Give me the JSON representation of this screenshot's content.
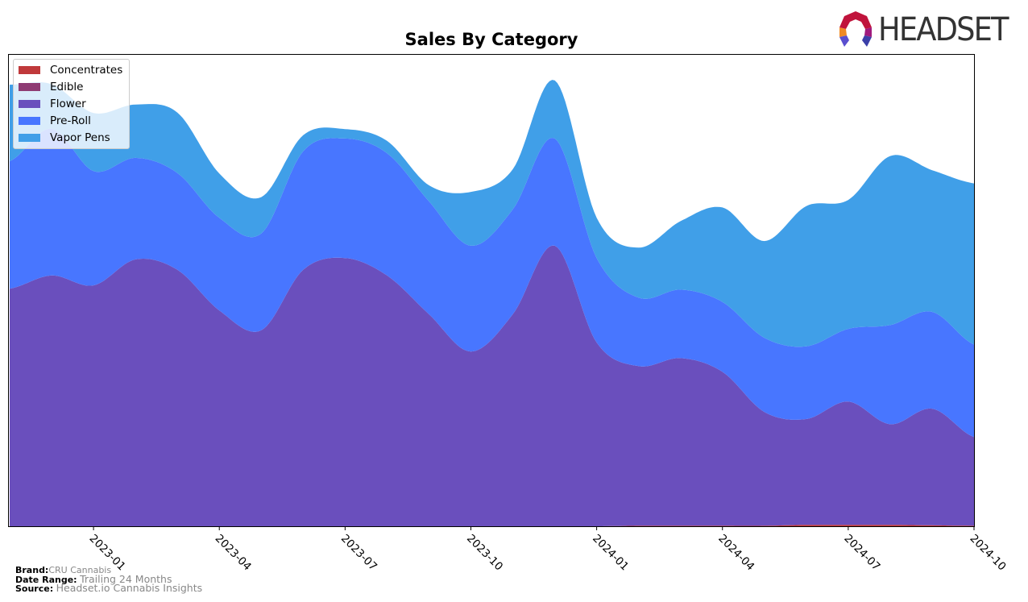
{
  "header": {
    "logo_text": "HEADSET",
    "logo_colors": [
      "#c0143c",
      "#f08a24",
      "#a01a7d",
      "#3b3fa8",
      "#5a4fcf"
    ]
  },
  "footer": {
    "brand_label": "Brand:",
    "brand_value": "CRU Cannabis",
    "date_range_label": "Date Range:",
    "date_range_value": "Trailing 24 Months",
    "source_label": "Source:",
    "source_value": "Headset.io Cannabis Insights"
  },
  "chart_data": {
    "type": "area",
    "stacked": true,
    "smoothed": true,
    "title": "Sales By Category",
    "xlabel": "",
    "ylabel": "",
    "y_ticks_visible": false,
    "grid": false,
    "legend_position": "top-left",
    "x": [
      "2022-11",
      "2022-12",
      "2023-01",
      "2023-02",
      "2023-03",
      "2023-04",
      "2023-05",
      "2023-06",
      "2023-07",
      "2023-08",
      "2023-09",
      "2023-10",
      "2023-11",
      "2023-12",
      "2024-01",
      "2024-02",
      "2024-03",
      "2024-04",
      "2024-05",
      "2024-06",
      "2024-07",
      "2024-08",
      "2024-09",
      "2024-10"
    ],
    "x_tick_labels": [
      "2023-01",
      "2023-04",
      "2023-07",
      "2023-10",
      "2024-01",
      "2024-04",
      "2024-07",
      "2024-10"
    ],
    "ylim": [
      0,
      100
    ],
    "series": [
      {
        "name": "Concentrates",
        "color": "#c0393b",
        "values": [
          0,
          0,
          0,
          0,
          0,
          0,
          0,
          0,
          0,
          0,
          0,
          0,
          0,
          0,
          0,
          0.1,
          0.1,
          0.1,
          0.1,
          0.3,
          0.3,
          0.3,
          0.2,
          0.1
        ]
      },
      {
        "name": "Edible",
        "color": "#8e3b73",
        "values": [
          0,
          0,
          0,
          0,
          0,
          0,
          0,
          0,
          0,
          0,
          0,
          0,
          0,
          0,
          0,
          0,
          0,
          0,
          0,
          0,
          0,
          0,
          0,
          0
        ]
      },
      {
        "name": "Flower",
        "color": "#6a4fbd",
        "values": [
          50.3,
          53.1,
          51.0,
          56.5,
          54.3,
          45.7,
          41.5,
          54.3,
          56.8,
          53.1,
          44.9,
          37.0,
          44.9,
          59.4,
          38.9,
          33.8,
          35.5,
          32.6,
          24.1,
          22.4,
          26.1,
          21.3,
          24.7,
          18.8
        ]
      },
      {
        "name": "Pre-Roll",
        "color": "#4876ff",
        "values": [
          27.0,
          31.1,
          24.2,
          21.5,
          20.5,
          19.6,
          20.5,
          25.1,
          25.3,
          25.9,
          23.9,
          22.4,
          22.2,
          22.7,
          17.9,
          14.5,
          14.5,
          14.8,
          15.7,
          15.4,
          15.4,
          21.0,
          20.5,
          19.6
        ]
      },
      {
        "name": "Vapor Pens",
        "color": "#409fe8",
        "values": [
          16.2,
          9.4,
          12.3,
          11.3,
          12.8,
          9.4,
          7.7,
          3.4,
          2.0,
          2.6,
          3.4,
          11.4,
          8.5,
          12.3,
          8.5,
          10.6,
          14.5,
          20.0,
          20.5,
          29.7,
          27.3,
          35.8,
          30.0,
          34.1
        ]
      }
    ]
  }
}
